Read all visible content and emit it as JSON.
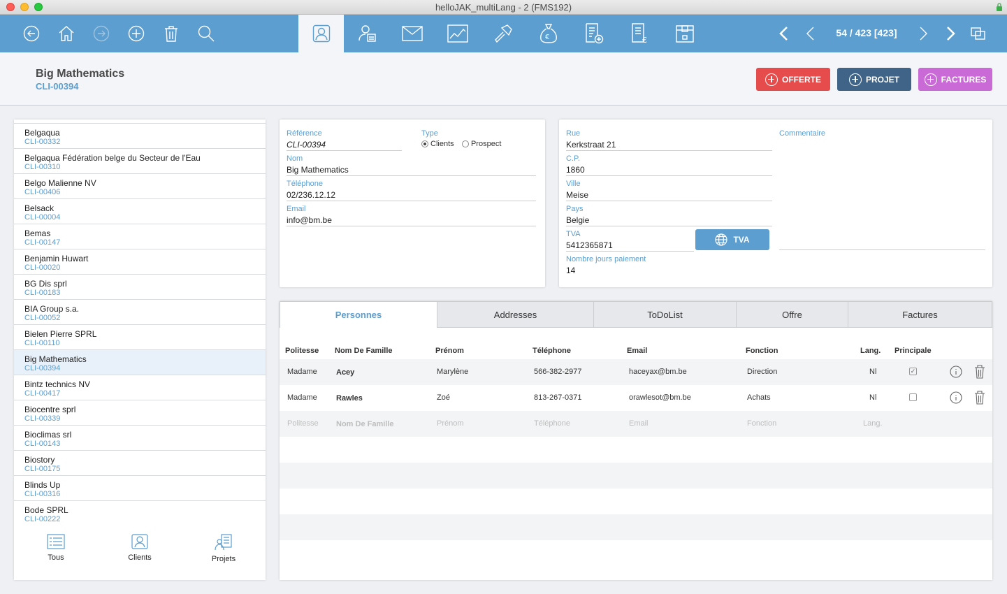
{
  "window": {
    "title": "helloJAK_multiLang - 2 (FMS192)"
  },
  "toolbar": {
    "left_icons": [
      "back-circle-icon",
      "home-icon",
      "forward-circle-icon",
      "add-circle-icon",
      "trash-icon",
      "search-icon"
    ],
    "module_icons": [
      "contact-card-icon",
      "person-doc-icon",
      "mail-icon",
      "chart-icon",
      "hammer-icon",
      "money-bag-icon",
      "invoice-add-icon",
      "invoice-euro-icon",
      "archive-box-icon"
    ],
    "active_module": "contact-card-icon",
    "record_counter": "54 / 423 [423]"
  },
  "header": {
    "name": "Big Mathematics",
    "code": "CLI-00394",
    "btn_offerte": "OFFERTE",
    "btn_projet": "PROJET",
    "btn_factures": "FACTURES",
    "colors": {
      "offerte": "#e74c4c",
      "projet": "#3f6488",
      "factures": "#c96ad6",
      "accent": "#5b9ecf"
    }
  },
  "list": {
    "items": [
      {
        "name": "Belgaqua",
        "code": "CLI-00332"
      },
      {
        "name": "Belgaqua Fédération belge du Secteur de l'Eau",
        "code": "CLI-00310"
      },
      {
        "name": "Belgo Malienne NV",
        "code": "CLI-00406"
      },
      {
        "name": "Belsack",
        "code": "CLI-00004"
      },
      {
        "name": "Bemas",
        "code": "CLI-00147"
      },
      {
        "name": "Benjamin Huwart",
        "code": "CLI-00020"
      },
      {
        "name": "BG Dis sprl",
        "code": "CLI-00183"
      },
      {
        "name": "BIA Group s.a.",
        "code": "CLI-00052"
      },
      {
        "name": "Bielen Pierre SPRL",
        "code": "CLI-00110"
      },
      {
        "name": "Big Mathematics",
        "code": "CLI-00394"
      },
      {
        "name": "Bintz technics NV",
        "code": "CLI-00417"
      },
      {
        "name": "Biocentre sprl",
        "code": "CLI-00339"
      },
      {
        "name": "Bioclimas srl",
        "code": "CLI-00143"
      },
      {
        "name": "Biostory",
        "code": "CLI-00175"
      },
      {
        "name": "Blinds Up",
        "code": "CLI-00316"
      },
      {
        "name": "Bode SPRL",
        "code": "CLI-00222"
      }
    ],
    "selected_index": 9,
    "footer": {
      "tous": "Tous",
      "clients": "Clients",
      "projets": "Projets"
    }
  },
  "form": {
    "reference_label": "Référence",
    "reference": "CLI-00394",
    "type_label": "Type",
    "type_clients": "Clients",
    "type_prospect": "Prospect",
    "type_selected": "Clients",
    "nom_label": "Nom",
    "nom": "Big Mathematics",
    "telephone_label": "Téléphone",
    "telephone": "02/236.12.12",
    "email_label": "Email",
    "email": "info@bm.be"
  },
  "address": {
    "rue_label": "Rue",
    "rue": "Kerkstraat 21",
    "cp_label": "C.P.",
    "cp": "1860",
    "ville_label": "Ville",
    "ville": "Meise",
    "pays_label": "Pays",
    "pays": "Belgie",
    "tva_label": "TVA",
    "tva": "5412365871",
    "tva_button": "TVA",
    "jours_label": "Nombre jours paiement",
    "jours": "14",
    "commentaire_label": "Commentaire",
    "commentaire": ""
  },
  "tabs": {
    "items": [
      "Personnes",
      "Addresses",
      "ToDoList",
      "Offre",
      "Factures"
    ],
    "active": "Personnes"
  },
  "persons": {
    "columns": [
      "Politesse",
      "Nom De Famille",
      "Prénom",
      "Téléphone",
      "Email",
      "Fonction",
      "Lang.",
      "Principale"
    ],
    "rows": [
      {
        "politesse": "Madame",
        "nom": "Acey",
        "prenom": "Marylène",
        "telephone": "566-382-2977",
        "email": "haceyax@bm.be",
        "fonction": "Direction",
        "lang": "Nl",
        "principale": true
      },
      {
        "politesse": "Madame",
        "nom": "Rawles",
        "prenom": "Zoé",
        "telephone": "813-267-0371",
        "email": "orawlesot@bm.be",
        "fonction": "Achats",
        "lang": "Nl",
        "principale": false
      }
    ],
    "placeholders": {
      "politesse": "Politesse",
      "nom": "Nom De Famille",
      "prenom": "Prénom",
      "telephone": "Téléphone",
      "email": "Email",
      "fonction": "Fonction",
      "lang": "Lang."
    }
  }
}
